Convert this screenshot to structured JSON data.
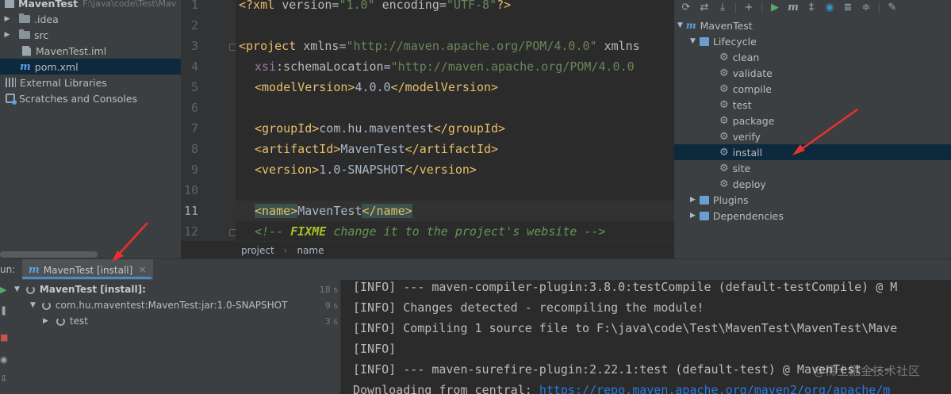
{
  "project": {
    "root_label": "MavenTest",
    "root_path": "F:\\java\\code\\Test\\Mav",
    "items": [
      {
        "label": ".idea"
      },
      {
        "label": "src"
      },
      {
        "label": "MavenTest.iml"
      },
      {
        "label": "pom.xml"
      },
      {
        "label": "External Libraries"
      },
      {
        "label": "Scratches and Consoles"
      }
    ]
  },
  "editor": {
    "line_numbers": [
      "1",
      "2",
      "3",
      "4",
      "5",
      "6",
      "7",
      "8",
      "9",
      "10",
      "11",
      "12"
    ],
    "current_line": "11",
    "xml_decl": {
      "open": "<?xml ",
      "k1": "version",
      "eq": "=",
      "v1": "\"1.0\"",
      "k2": "encoding",
      "v2": "\"UTF-8\"",
      "close": "?>"
    },
    "project_line": {
      "open": "<project ",
      "k1": "xmlns",
      "eq": "=",
      "v1": "\"http://maven.apache.org/POM/4.0.0\"",
      "rest": " xmlns"
    },
    "schema_line": {
      "ns": "xsi",
      "k": ":schemaLocation",
      "eq": "=",
      "v": "\"http://maven.apache.org/POM/4.0.0"
    },
    "model_version": {
      "open": "<modelVersion>",
      "text": "4.0.0",
      "close": "</modelVersion>"
    },
    "group_id": {
      "open": "<groupId>",
      "text": "com.hu.maventest",
      "close": "</groupId>"
    },
    "artifact_id": {
      "open": "<artifactId>",
      "text": "MavenTest",
      "close": "</artifactId>"
    },
    "version": {
      "open": "<version>",
      "text": "1.0-SNAPSHOT",
      "close": "</version>"
    },
    "name": {
      "open": "<name>",
      "text": "MavenTest",
      "close": "</name>"
    },
    "comment": {
      "open": "<!-- ",
      "todo": "FIXME",
      "text": " change it to the project's website -->"
    }
  },
  "breadcrumb": {
    "items": [
      "project",
      "name"
    ]
  },
  "maven": {
    "root": "MavenTest",
    "lifecycle": "Lifecycle",
    "phases": [
      "clean",
      "validate",
      "compile",
      "test",
      "package",
      "verify",
      "install",
      "site",
      "deploy"
    ],
    "selected_phase": "install",
    "plugins": "Plugins",
    "dependencies": "Dependencies"
  },
  "run": {
    "label": "un:",
    "tab_label": "MavenTest [install]",
    "tree": [
      {
        "label": "MavenTest [install]:",
        "time": "18 s"
      },
      {
        "label": "com.hu.maventest:MavenTest:jar:1.0-SNAPSHOT",
        "time": "9 s"
      },
      {
        "label": "test",
        "time": "3 s"
      }
    ],
    "console": [
      "[INFO] --- maven-compiler-plugin:3.8.0:testCompile (default-testCompile) @ M",
      "[INFO] Changes detected - recompiling the module!",
      "[INFO] Compiling 1 source file to F:\\java\\code\\Test\\MavenTest\\MavenTest\\Mave",
      "[INFO]",
      "[INFO] --- maven-surefire-plugin:2.22.1:test (default-test) @ MavenTest ---"
    ],
    "download_prefix": "Downloading from central: ",
    "download_url": "https://repo.maven.apache.org/maven2/org/apache/m"
  },
  "watermark": "@稀土掘金技术社区",
  "colors": {
    "accent": "#4a88c7",
    "arrow": "#e8302f",
    "selection": "#0d293e"
  }
}
